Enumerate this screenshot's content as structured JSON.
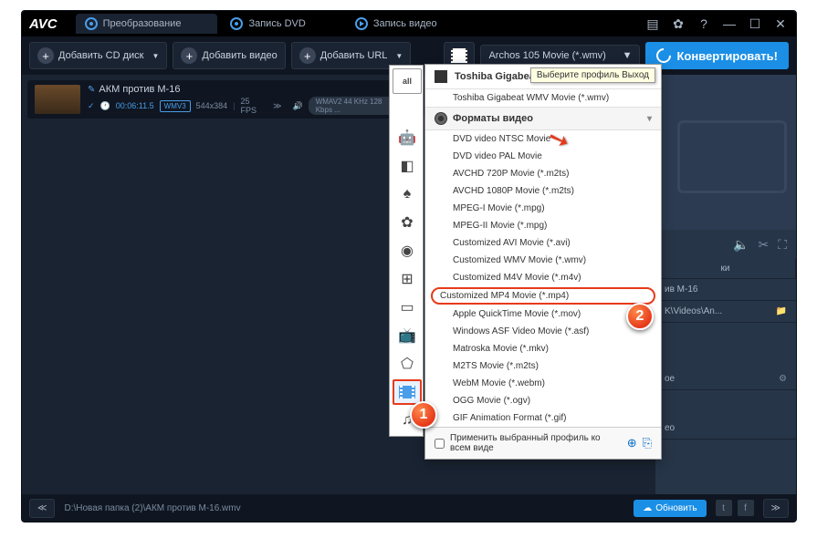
{
  "logo": "AVC",
  "tabs": [
    {
      "label": "Преобразование",
      "active": true,
      "icon": "disc"
    },
    {
      "label": "Запись DVD",
      "active": false,
      "icon": "disc"
    },
    {
      "label": "Запись видео",
      "active": false,
      "icon": "play"
    }
  ],
  "toolbar": {
    "add_cd": "Добавить CD диск",
    "add_video": "Добавить видео",
    "add_url": "Добавить URL",
    "format_selected": "Archos 105 Movie (*.wmv)",
    "convert": "Конвертировать!"
  },
  "file": {
    "name": "АКМ против М-16",
    "duration": "00:06:11.5",
    "vcodec": "WMV3",
    "resolution": "544x384",
    "fps": "25 FPS",
    "acodec": "WMAV2 44 KHz 128 Kbps ..."
  },
  "dropdown": {
    "header_brand": "Toshiba Gigabeat",
    "header_tooltip": "Выберите профиль Выход",
    "item_top": "Toshiba Gigabeat WMV Movie (*.wmv)",
    "section": "Форматы видео",
    "items": [
      "DVD video NTSC Movie",
      "DVD video PAL Movie",
      "AVCHD 720P Movie (*.m2ts)",
      "AVCHD 1080P Movie (*.m2ts)",
      "MPEG-I Movie (*.mpg)",
      "MPEG-II Movie (*.mpg)",
      "Customized AVI Movie (*.avi)",
      "Customized WMV Movie (*.wmv)",
      "Customized M4V Movie (*.m4v)",
      "Customized MP4 Movie (*.mp4)",
      "Apple QuickTime Movie (*.mov)",
      "Windows ASF Video Movie (*.asf)",
      "Matroska Movie (*.mkv)",
      "M2TS Movie (*.m2ts)",
      "WebM Movie (*.webm)",
      "OGG Movie (*.ogv)",
      "GIF Animation Format (*.gif)"
    ],
    "selected_index": 9,
    "footer": "Применить выбранный профиль ко всем виде"
  },
  "right_panel": {
    "tab1": "ки",
    "row1": "ив М-16",
    "row2": "K\\Videos\\An...",
    "row3": "ое",
    "row4": "ео"
  },
  "status": {
    "path": "D:\\Новая папка (2)\\АКМ против М-16.wmv",
    "refresh": "Обновить"
  },
  "callouts": {
    "c1": "1",
    "c2": "2"
  }
}
